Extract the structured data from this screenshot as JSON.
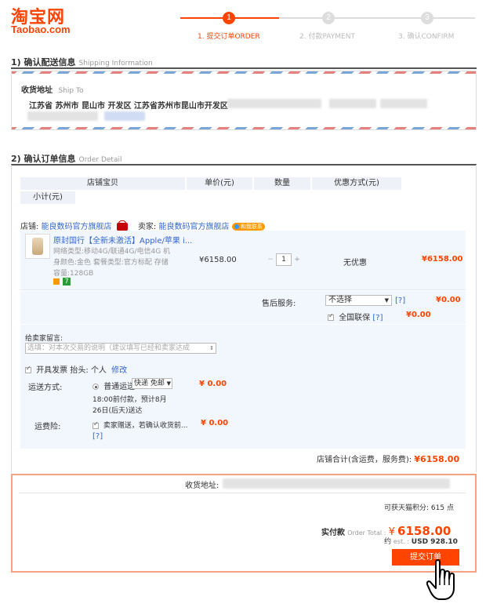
{
  "header": {
    "logo_cn": "淘宝网",
    "logo_en": "Taobao.com",
    "steps": [
      {
        "num": "1",
        "label": "1. 提交订单ORDER",
        "active": true
      },
      {
        "num": "2",
        "label": "2. 付款PAYMENT",
        "active": false
      },
      {
        "num": "3",
        "label": "3. 确认CONFIRM",
        "active": false
      }
    ]
  },
  "shipping": {
    "title": "1) 确认配送信息",
    "title_en": "Shipping Information",
    "ship_to_label": "收货地址",
    "ship_to_en": "Ship To",
    "address": "江苏省 苏州市 昆山市 开发区 江苏省苏州市昆山市开发区"
  },
  "order": {
    "title": "2) 确认订单信息",
    "title_en": "Order Detail",
    "columns": [
      "店铺宝贝",
      "单价(元)",
      "数量",
      "优惠方式(元)",
      "小计(元)"
    ],
    "shop_label": "店铺:",
    "shop_name": "能良数码官方旗舰店",
    "seller_label": "卖家:",
    "seller_name": "能良数码官方旗舰店",
    "seller_badge": "和我联系",
    "item": {
      "title": "原封国行【全新未激活】Apple/苹果 i...",
      "spec1": "网络类型:移动4G/联通4G/电信4G 机",
      "spec2": "身颜色:金色 套餐类型:官方标配 存储",
      "spec3": "容量:128GB",
      "price": "¥6158.00",
      "qty": "1",
      "discount": "无优惠",
      "subtotal": "¥6158.00"
    },
    "after_sale": {
      "label": "售后服务:",
      "select_value": "不选择",
      "help": "[?]",
      "price": "¥0.00",
      "warranty_label": "全国联保",
      "warranty_help": "[?]",
      "warranty_price": "¥0.00"
    },
    "message": {
      "label": "给卖家留言:",
      "placeholder": "选填：对本次交易的说明（建议填写已经和卖家达成"
    },
    "invoice": {
      "label": "开具发票",
      "title_label": "抬头:",
      "title_value": "个人",
      "edit": "修改"
    },
    "delivery": {
      "label": "运送方式:",
      "option": "普通运送",
      "select_value": "快递 免邮",
      "price": "¥ 0.00",
      "note1": "18:00前付款，预计8月",
      "note2": "26日(后天)送达"
    },
    "insurance": {
      "label": "运费险:",
      "text": "卖家赠送，若确认收货前...",
      "help": "[?]",
      "price": "¥ 0.00"
    },
    "shop_total_label": "店铺合计(含运费，服务费):",
    "shop_total": "¥6158.00"
  },
  "summary": {
    "address_label": "收货地址:",
    "points_label": "可获天猫积分:",
    "points_value": "615 点",
    "pay_label": "实付款",
    "pay_label_en": "Order Total :",
    "pay_currency": "¥",
    "pay_amount": "6158.00",
    "est_label_cn": "约",
    "est_label_en": "est. :",
    "est_value": "USD 928.10",
    "submit": "提交订单"
  },
  "colors": {
    "accent": "#ff4400",
    "link": "#3366cc",
    "summary_border": "#f7a27f"
  }
}
